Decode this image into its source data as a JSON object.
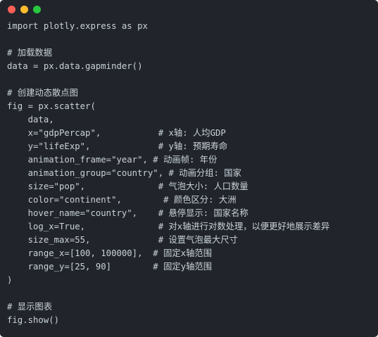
{
  "window": {
    "background": "#21252b",
    "controls": [
      {
        "name": "close",
        "color": "#ff5f56"
      },
      {
        "name": "minimize",
        "color": "#ffbd2e"
      },
      {
        "name": "maximize",
        "color": "#27c93f"
      }
    ]
  },
  "code": {
    "text_color": "#c9d1d9",
    "lines": [
      "import plotly.express as px",
      "",
      "# 加载数据",
      "data = px.data.gapminder()",
      "",
      "# 创建动态散点图",
      "fig = px.scatter(",
      "    data,",
      "    x=\"gdpPercap\",           # x轴: 人均GDP",
      "    y=\"lifeExp\",             # y轴: 预期寿命",
      "    animation_frame=\"year\", # 动画帧: 年份",
      "    animation_group=\"country\", # 动画分组: 国家",
      "    size=\"pop\",              # 气泡大小: 人口数量",
      "    color=\"continent\",        # 颜色区分: 大洲",
      "    hover_name=\"country\",    # 悬停显示: 国家名称",
      "    log_x=True,              # 对x轴进行对数处理，以便更好地展示差异",
      "    size_max=55,             # 设置气泡最大尺寸",
      "    range_x=[100, 100000],  # 固定x轴范围",
      "    range_y=[25, 90]        # 固定y轴范围",
      ")",
      "",
      "# 显示图表",
      "fig.show()"
    ]
  }
}
